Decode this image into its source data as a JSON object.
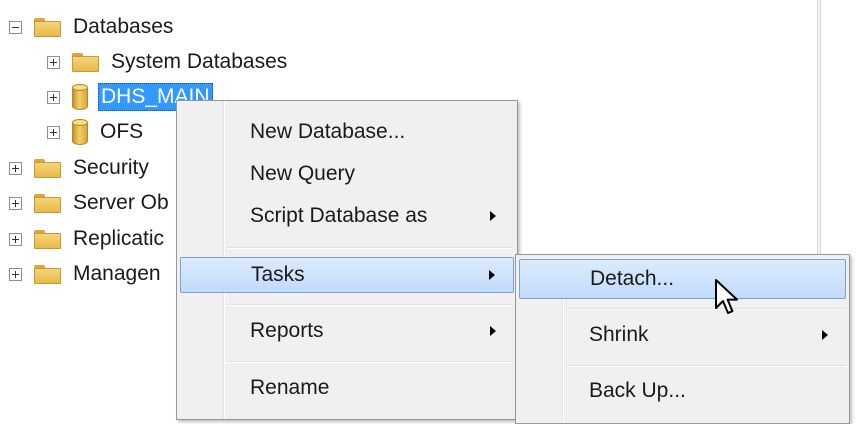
{
  "tree": {
    "databases": "Databases",
    "system_databases": "System Databases",
    "dhs_main": "DHS_MAIN",
    "ofs": "OFS",
    "security": "Security",
    "server_objects": "Server Ob",
    "replication": "Replicatic",
    "management": "Managen"
  },
  "context_menu": {
    "new_database": "New Database...",
    "new_query": "New Query",
    "script_database_as": "Script Database as",
    "tasks": "Tasks",
    "reports": "Reports",
    "rename": "Rename"
  },
  "tasks_submenu": {
    "detach": "Detach...",
    "shrink": "Shrink",
    "back_up": "Back Up..."
  },
  "icons": {
    "folder": "folder-icon",
    "database": "database-icon",
    "expand": "plus-icon",
    "collapse": "minus-icon",
    "submenu": "submenu-arrow-icon",
    "cursor": "mouse-pointer-icon"
  },
  "colors": {
    "selection": "#3399ff",
    "menu_highlight": "#c1dbfc",
    "menu_highlight_border": "#7da2ce",
    "menu_background": "#f0f0f0",
    "folder": "#f5d57a"
  }
}
